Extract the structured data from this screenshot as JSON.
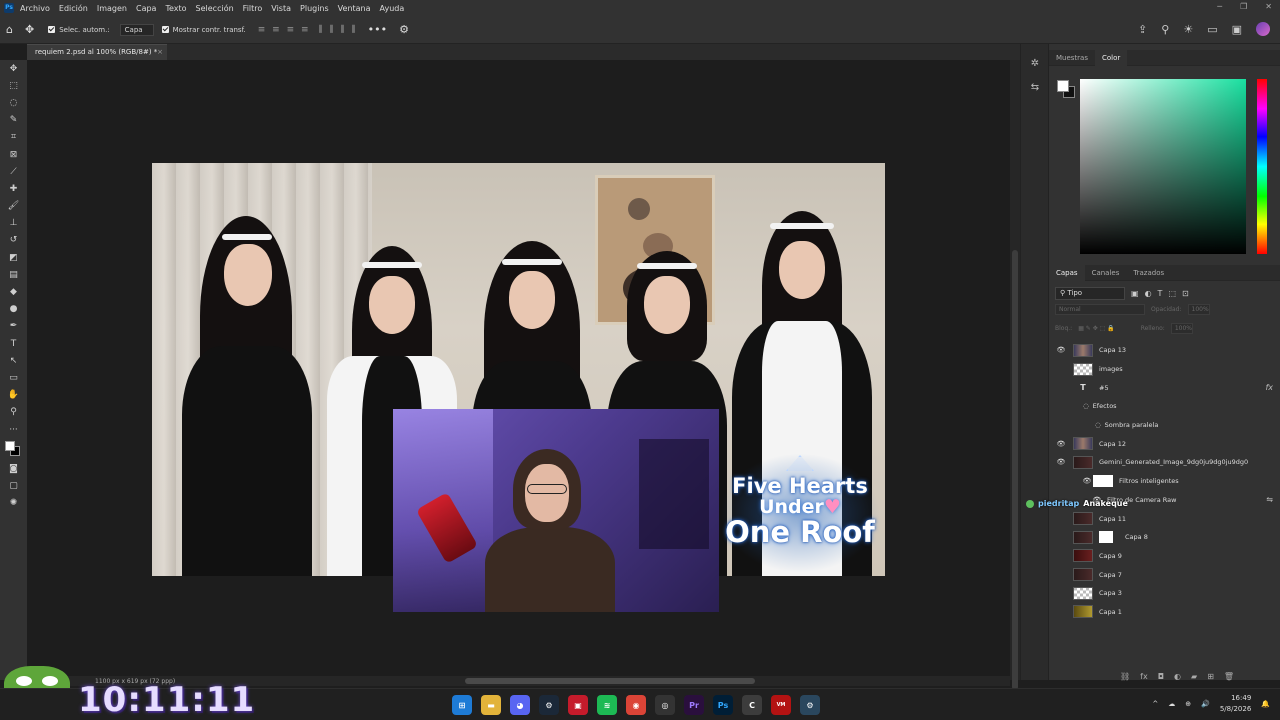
{
  "app": {
    "logo": "Ps"
  },
  "menu": {
    "items": [
      "Archivo",
      "Edición",
      "Imagen",
      "Capa",
      "Texto",
      "Selección",
      "Filtro",
      "Vista",
      "Plugins",
      "Ventana",
      "Ayuda"
    ]
  },
  "options": {
    "auto_select_label": "Selec. autom.:",
    "auto_select_value": "Capa",
    "show_transform_label": "Mostrar contr. transf."
  },
  "document": {
    "tab_title": "requiem 2.psd al 100% (RGB/8#) *",
    "status": "1100 px x 619 px (72 ppp)"
  },
  "canvas_content": {
    "logo_line1": "Five Hearts",
    "logo_line2": "Under",
    "logo_line3": "One Roof"
  },
  "right_panels": {
    "top_tabs": [
      "Muestras",
      "Color"
    ],
    "top_active": "Color",
    "layer_tabs": [
      "Capas",
      "Canales",
      "Trazados"
    ],
    "layer_active": "Capas",
    "filter_kind": "Tipo",
    "blend_mode": "Normal",
    "opacity_label": "Opacidad:",
    "opacity_value": "100%",
    "lock_label": "Bloq.:",
    "fill_label": "Relleno:",
    "fill_value": "100%"
  },
  "layers": [
    {
      "name": "Capa 13",
      "thumb": "photo",
      "visible": true
    },
    {
      "name": "images",
      "thumb": "checker",
      "visible": false
    },
    {
      "name": "#5",
      "thumb": "text",
      "visible": false,
      "fx": "fx"
    },
    {
      "name": "Efectos",
      "sub": true,
      "visible": false
    },
    {
      "name": "Sombra paralela",
      "sub": true,
      "visible": false
    },
    {
      "name": "Capa 12",
      "thumb": "photo",
      "visible": true
    },
    {
      "name": "Gemini_Generated_Image_9dg0ju9dg0ju9dg0",
      "thumb": "dark",
      "visible": true
    },
    {
      "name": "Filtros inteligentes",
      "sub": true,
      "visible": true
    },
    {
      "name": "Filtro de Camera Raw",
      "sub": true,
      "visible": true
    },
    {
      "name": "Capa 11",
      "thumb": "dark",
      "visible": false
    },
    {
      "name": "Capa 8",
      "thumb": "dark",
      "visible": false
    },
    {
      "name": "Capa 9",
      "thumb": "red",
      "visible": false
    },
    {
      "name": "Capa 7",
      "thumb": "dark",
      "visible": false
    },
    {
      "name": "Capa 3",
      "thumb": "checker",
      "visible": false
    },
    {
      "name": "Capa 1",
      "thumb": "gold",
      "visible": false
    }
  ],
  "chat": {
    "user1": "piedritap",
    "user2": "Anakeque"
  },
  "overlay": {
    "timer": "10:11:11"
  },
  "taskbar": {
    "time": "16:49",
    "date": "5/8/2026"
  }
}
